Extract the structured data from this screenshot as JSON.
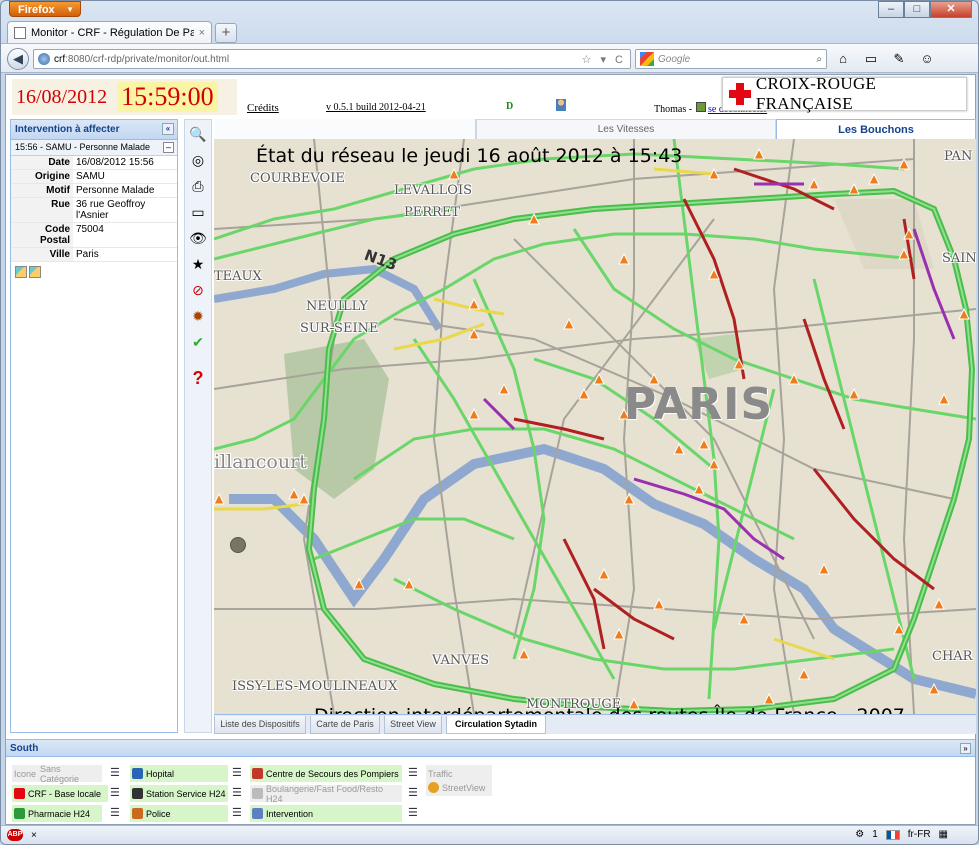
{
  "browser": {
    "menu_button": "Firefox",
    "tab_title": "Monitor - CRF - Régulation De Paris",
    "url_host": "crf",
    "url_rest": ":8080/crf-rdp/private/monitor/out.html",
    "search_placeholder": "Google",
    "window_controls": [
      "minimize",
      "maximize",
      "close"
    ]
  },
  "header": {
    "date": "16/08/2012",
    "time": "15:59:00",
    "credits": "Crédits",
    "version": "v 0.5.1 build 2012-04-21",
    "d_label": "D",
    "user": "Thomas -",
    "logout": "se déconnecter",
    "logo_text": "CROIX-ROUGE FRANÇAISE",
    "logo_color": "#e30613"
  },
  "left_panel": {
    "title": "Intervention à affecter",
    "item": "15:56 - SAMU - Personne Malade",
    "fields": [
      {
        "label": "Date",
        "value": "16/08/2012 15:56"
      },
      {
        "label": "Origine",
        "value": "SAMU"
      },
      {
        "label": "Motif",
        "value": "Personne Malade"
      },
      {
        "label": "Rue",
        "value": "36 rue Geoffroy l'Asnier"
      },
      {
        "label": "Code Postal",
        "value": "75004"
      },
      {
        "label": "Ville",
        "value": "Paris"
      }
    ]
  },
  "toolbar": {
    "icons": [
      "zoom-in-icon",
      "zoom-extent-icon",
      "print-icon",
      "measure-icon",
      "view-icon",
      "select-icon",
      "forbidden-icon",
      "bug-icon",
      "check-icon",
      "help-icon"
    ]
  },
  "map_tabs": {
    "vitesses": "Les Vitesses",
    "bouchons": "Les Bouchons"
  },
  "map": {
    "title": "État du réseau le jeudi 16 août 2012 à 15:43",
    "footer": "Direction interdépartementale des routes Île-de-France - 2007",
    "city": "PARIS",
    "road_label": "N13",
    "places": [
      "COURBEVOIE",
      "LEVALLOIS",
      "PERRET",
      "NEUILLY",
      "SUR-SEINE",
      "TEAUX",
      "illancourt",
      "VANVES",
      "ISSY-LES-MOULINEAUX",
      "MONTROUGE",
      "PAN",
      "SAIN",
      "CHAR"
    ],
    "colors": {
      "fluid": "#6ad66a",
      "congested": "#b02020",
      "slow": "#e8d84a",
      "river": "#8fa8d0",
      "closed": "#9a2fb0"
    }
  },
  "bottom_tabs": [
    "Liste des Dispositifs",
    "Carte de Paris",
    "Street View",
    "Circulation Sytadin"
  ],
  "south": {
    "title": "South",
    "legend": [
      {
        "label": "Sans Catégorie",
        "prefix": "Icone",
        "style": "grey"
      },
      {
        "label": "Hopital",
        "style": "green"
      },
      {
        "label": "Centre de Secours des Pompiers",
        "style": "green"
      },
      {
        "label": "Traffic",
        "style": "grey"
      },
      {
        "label": "CRF - Base locale",
        "style": "green"
      },
      {
        "label": "Station Service H24",
        "style": "green"
      },
      {
        "label": "Boulangerie/Fast Food/Resto H24",
        "style": "grey"
      },
      {
        "label": "StreetView",
        "style": "grey"
      },
      {
        "label": "Pharmacie H24",
        "style": "green"
      },
      {
        "label": "Police",
        "style": "green"
      },
      {
        "label": "Intervention",
        "style": "green"
      }
    ]
  },
  "statusbar": {
    "count": "1",
    "locale": "fr-FR",
    "close": "×"
  }
}
